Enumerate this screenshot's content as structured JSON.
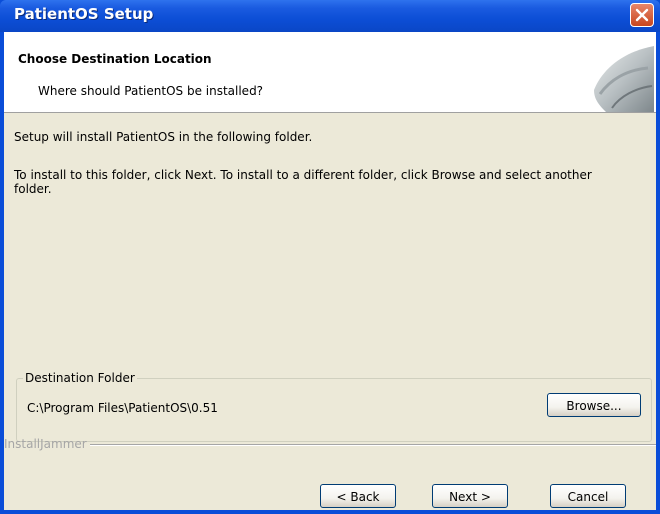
{
  "window": {
    "title": "PatientOS Setup",
    "close_icon": "close-icon"
  },
  "header": {
    "title": "Choose Destination Location",
    "subtitle": "Where should PatientOS be installed?"
  },
  "body": {
    "line1": "Setup will install PatientOS in the following folder.",
    "line2a": "To install  to this folder, click Next.  To install to a different folder, click  Browse and select another",
    "line2b": "folder."
  },
  "destination": {
    "group_label": "Destination Folder",
    "path": "C:\\Program Files\\PatientOS\\0.51",
    "browse_label": "Browse..."
  },
  "footer": {
    "brand": "InstallJammer",
    "back_label": "< Back",
    "next_label": "Next >",
    "cancel_label": "Cancel"
  },
  "colors": {
    "titlebar": "#0A4DD8",
    "dialog_bg": "#ECE9D8",
    "close_button": "#C8461E"
  }
}
